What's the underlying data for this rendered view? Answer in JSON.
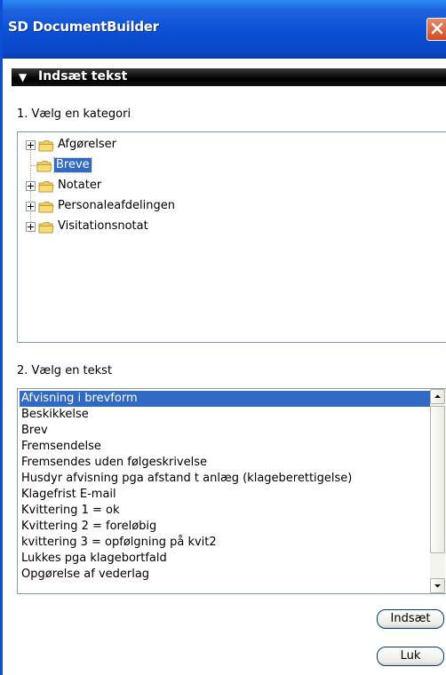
{
  "window": {
    "title": "SD DocumentBuilder"
  },
  "section": {
    "header": "Indsæt tekst"
  },
  "category": {
    "label": "1. Vælg en kategori",
    "items": [
      {
        "label": "Afgørelser",
        "expandable": true,
        "selected": false
      },
      {
        "label": "Breve",
        "expandable": false,
        "selected": true
      },
      {
        "label": "Notater",
        "expandable": true,
        "selected": false
      },
      {
        "label": "Personaleafdelingen",
        "expandable": true,
        "selected": false
      },
      {
        "label": "Visitationsnotat",
        "expandable": true,
        "selected": false
      }
    ]
  },
  "text_list": {
    "label": "2. Vælg en tekst",
    "items": [
      "Afvisning i brevform",
      "Beskikkelse",
      "Brev",
      "Fremsendelse",
      "Fremsendes uden følgeskrivelse",
      "Husdyr afvisning pga afstand t anlæg (klageberettigelse)",
      "Klagefrist E-mail",
      "Kvittering 1 = ok",
      "Kvittering 2 = foreløbig",
      "kvittering 3 = opfølgning på kvit2",
      "Lukkes pga klagebortfald",
      "Opgørelse af vederlag"
    ],
    "selected_index": 0
  },
  "buttons": {
    "insert": "Indsæt",
    "close": "Luk"
  },
  "colors": {
    "titlebar": "#0b4fd4",
    "selection": "#316ac5",
    "close_button": "#d54a20"
  }
}
